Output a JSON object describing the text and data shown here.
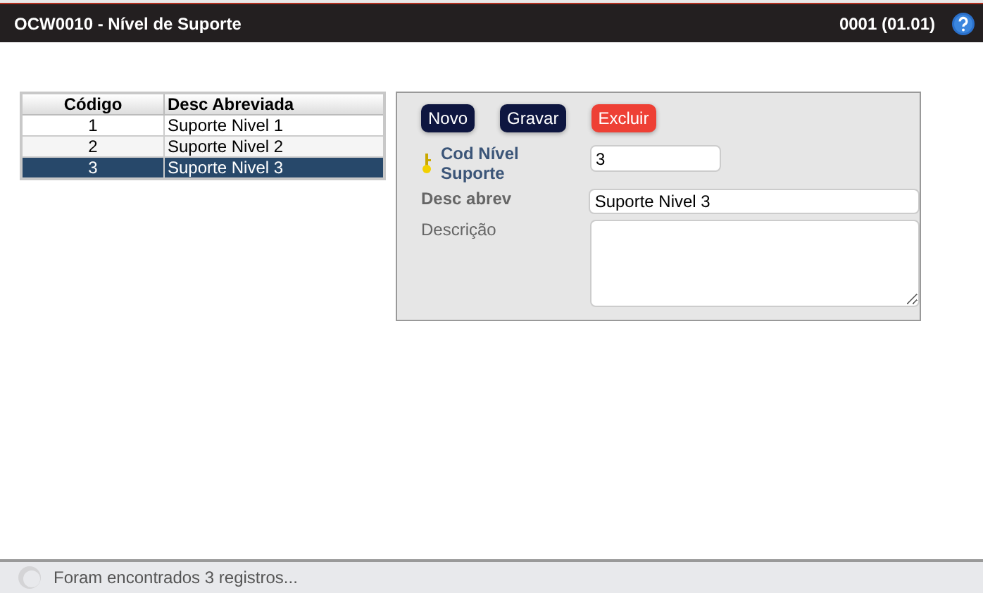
{
  "window": {
    "title": "OCW0010 - Nível de Suporte",
    "version": "0001 (01.01)"
  },
  "table": {
    "columns": [
      "Código",
      "Desc Abreviada"
    ],
    "rows": [
      {
        "cells": [
          "1",
          "Suporte Nivel 1"
        ],
        "selected": false
      },
      {
        "cells": [
          "2",
          "Suporte Nivel 2"
        ],
        "selected": false
      },
      {
        "cells": [
          "3",
          "Suporte Nivel 3"
        ],
        "selected": true
      }
    ]
  },
  "form": {
    "buttons": [
      {
        "label": "Novo",
        "kind": "primary"
      },
      {
        "label": "Gravar",
        "kind": "primary"
      },
      {
        "label": "Excluir",
        "kind": "danger"
      }
    ],
    "fields": [
      {
        "label": "Cod Nível Suporte",
        "kind": "short",
        "key": true,
        "required": true,
        "value": "3"
      },
      {
        "label": "Desc abrev",
        "kind": "long",
        "key": false,
        "required": true,
        "value": "Suporte Nivel 3"
      },
      {
        "label": "Descrição",
        "kind": "textarea",
        "key": false,
        "required": false
      }
    ]
  },
  "status_bar": {
    "text": "Foram encontrados 3 registros..."
  }
}
